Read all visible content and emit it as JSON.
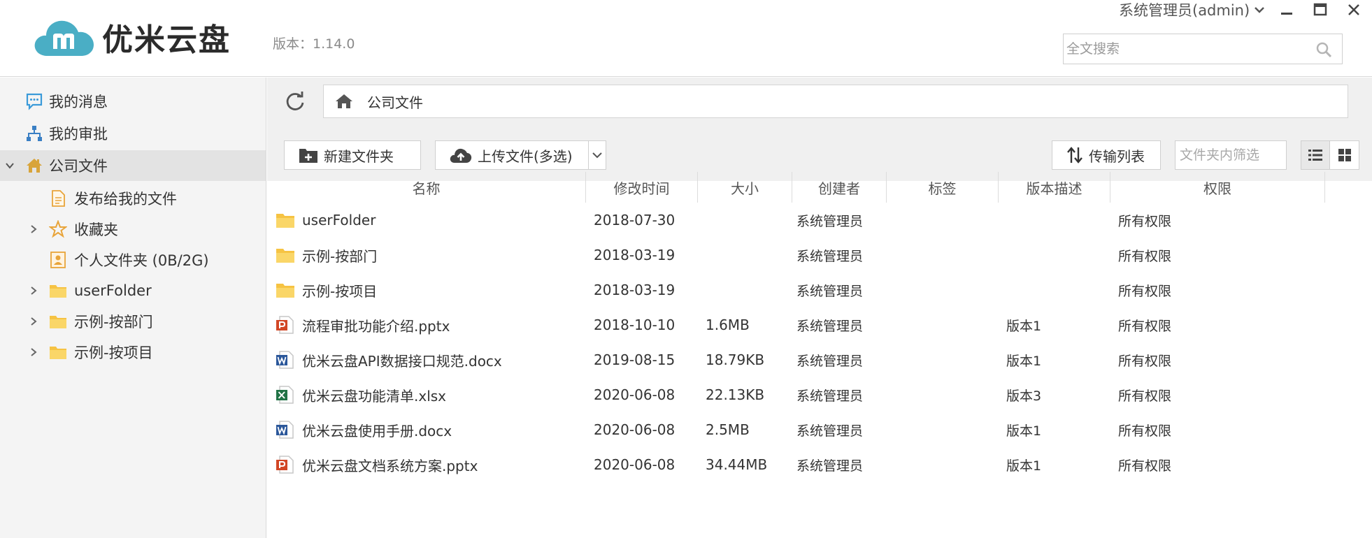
{
  "header": {
    "brand": "优米云盘",
    "version": "版本：1.14.0",
    "user": "系统管理员(admin)",
    "search_placeholder": "全文搜索"
  },
  "sidebar": {
    "items": [
      {
        "label": "我的消息",
        "icon": "message-icon"
      },
      {
        "label": "我的审批",
        "icon": "org-tree-icon"
      },
      {
        "label": "公司文件",
        "icon": "home-icon",
        "expanded": true,
        "active": true
      },
      {
        "label": "发布给我的文件",
        "icon": "document-icon"
      },
      {
        "label": "收藏夹",
        "icon": "star-icon",
        "collapsed": true
      },
      {
        "label": "个人文件夹 (0B/2G)",
        "icon": "person-folder-icon"
      },
      {
        "label": "userFolder",
        "icon": "folder-icon",
        "collapsed": true
      },
      {
        "label": "示例-按部门",
        "icon": "folder-icon",
        "collapsed": true
      },
      {
        "label": "示例-按项目",
        "icon": "folder-icon",
        "collapsed": true
      }
    ]
  },
  "breadcrumb": {
    "path": "公司文件"
  },
  "toolbar": {
    "new_folder": "新建文件夹",
    "upload": "上传文件(多选)",
    "transfer_list": "传输列表",
    "filter_placeholder": "文件夹内筛选"
  },
  "table": {
    "columns": [
      "名称",
      "修改时间",
      "大小",
      "创建者",
      "标签",
      "版本描述",
      "权限"
    ],
    "rows": [
      {
        "name": "userFolder",
        "type": "folder",
        "time": "2018-07-30",
        "size": "",
        "creator": "系统管理员",
        "tag": "",
        "version": "",
        "perm": "所有权限"
      },
      {
        "name": "示例-按部门",
        "type": "folder",
        "time": "2018-03-19",
        "size": "",
        "creator": "系统管理员",
        "tag": "",
        "version": "",
        "perm": "所有权限"
      },
      {
        "name": "示例-按项目",
        "type": "folder",
        "time": "2018-03-19",
        "size": "",
        "creator": "系统管理员",
        "tag": "",
        "version": "",
        "perm": "所有权限"
      },
      {
        "name": "流程审批功能介绍.pptx",
        "type": "pptx",
        "time": "2018-10-10",
        "size": "1.6MB",
        "creator": "系统管理员",
        "tag": "",
        "version": "版本1",
        "perm": "所有权限"
      },
      {
        "name": "优米云盘API数据接口规范.docx",
        "type": "docx",
        "time": "2019-08-15",
        "size": "18.79KB",
        "creator": "系统管理员",
        "tag": "",
        "version": "版本1",
        "perm": "所有权限"
      },
      {
        "name": "优米云盘功能清单.xlsx",
        "type": "xlsx",
        "time": "2020-06-08",
        "size": "22.13KB",
        "creator": "系统管理员",
        "tag": "",
        "version": "版本3",
        "perm": "所有权限"
      },
      {
        "name": "优米云盘使用手册.docx",
        "type": "docx",
        "time": "2020-06-08",
        "size": "2.5MB",
        "creator": "系统管理员",
        "tag": "",
        "version": "版本1",
        "perm": "所有权限"
      },
      {
        "name": "优米云盘文档系统方案.pptx",
        "type": "pptx",
        "time": "2020-06-08",
        "size": "34.44MB",
        "creator": "系统管理员",
        "tag": "",
        "version": "版本1",
        "perm": "所有权限"
      }
    ]
  },
  "colors": {
    "brand_teal": "#4aaec5",
    "folder_yellow": "#f6c343",
    "ppt_red": "#d24726",
    "word_blue": "#2b579a",
    "excel_green": "#217346",
    "sidebar_bg": "#f4f4f4",
    "sidebar_active_bg": "#e3e3e3"
  }
}
